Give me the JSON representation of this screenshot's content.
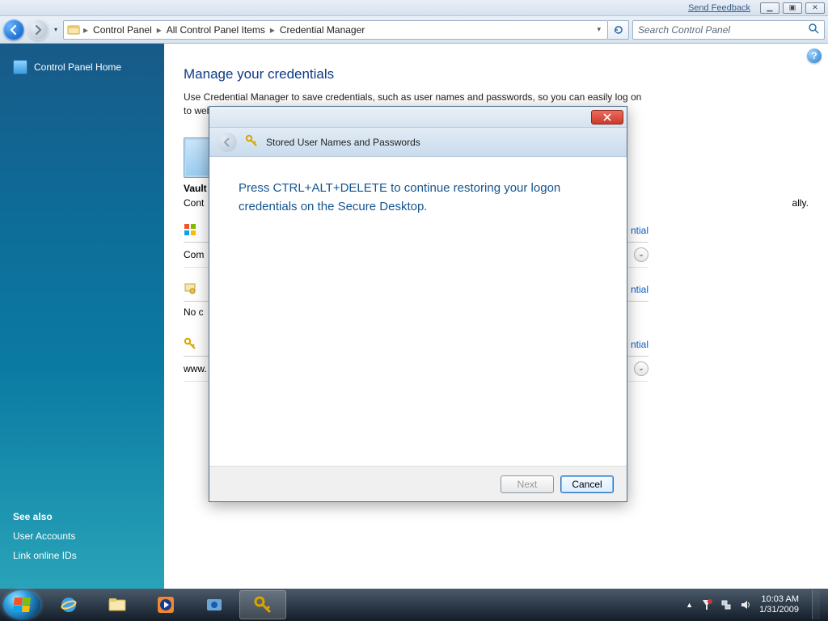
{
  "titlebar": {
    "feedback": "Send Feedback"
  },
  "breadcrumb": {
    "root_icon": "folder",
    "items": [
      "Control Panel",
      "All Control Panel Items",
      "Credential Manager"
    ]
  },
  "search": {
    "placeholder": "Search Control Panel"
  },
  "sidebar": {
    "home": "Control Panel Home",
    "seealso_heading": "See also",
    "seealso": [
      "User Accounts",
      "Link online IDs"
    ]
  },
  "page": {
    "heading": "Manage your credentials",
    "description": "Use Credential Manager to save credentials, such as user names and passwords, so you can easily log on to websi",
    "vault_label": "Vault",
    "vault_sub_prefix": "Cont",
    "vault_sub_suffix": "ally.",
    "sections": [
      {
        "label_prefix": "Com",
        "link_suffix": "ntial",
        "row_prefix": "",
        "has_expand": true,
        "icon": "win"
      },
      {
        "label_prefix": "No c",
        "link_suffix": "ntial",
        "row_prefix": "",
        "has_expand": false,
        "icon": "cert"
      },
      {
        "label_prefix": "www.",
        "link_suffix": "ntial",
        "row_prefix": "",
        "has_expand": true,
        "icon": "key"
      }
    ]
  },
  "dialog": {
    "title": "Stored User Names and Passwords",
    "message": "Press CTRL+ALT+DELETE to continue restoring your logon credentials on the Secure Desktop.",
    "next": "Next",
    "cancel": "Cancel"
  },
  "tray": {
    "time": "10:03 AM",
    "date": "1/31/2009"
  }
}
